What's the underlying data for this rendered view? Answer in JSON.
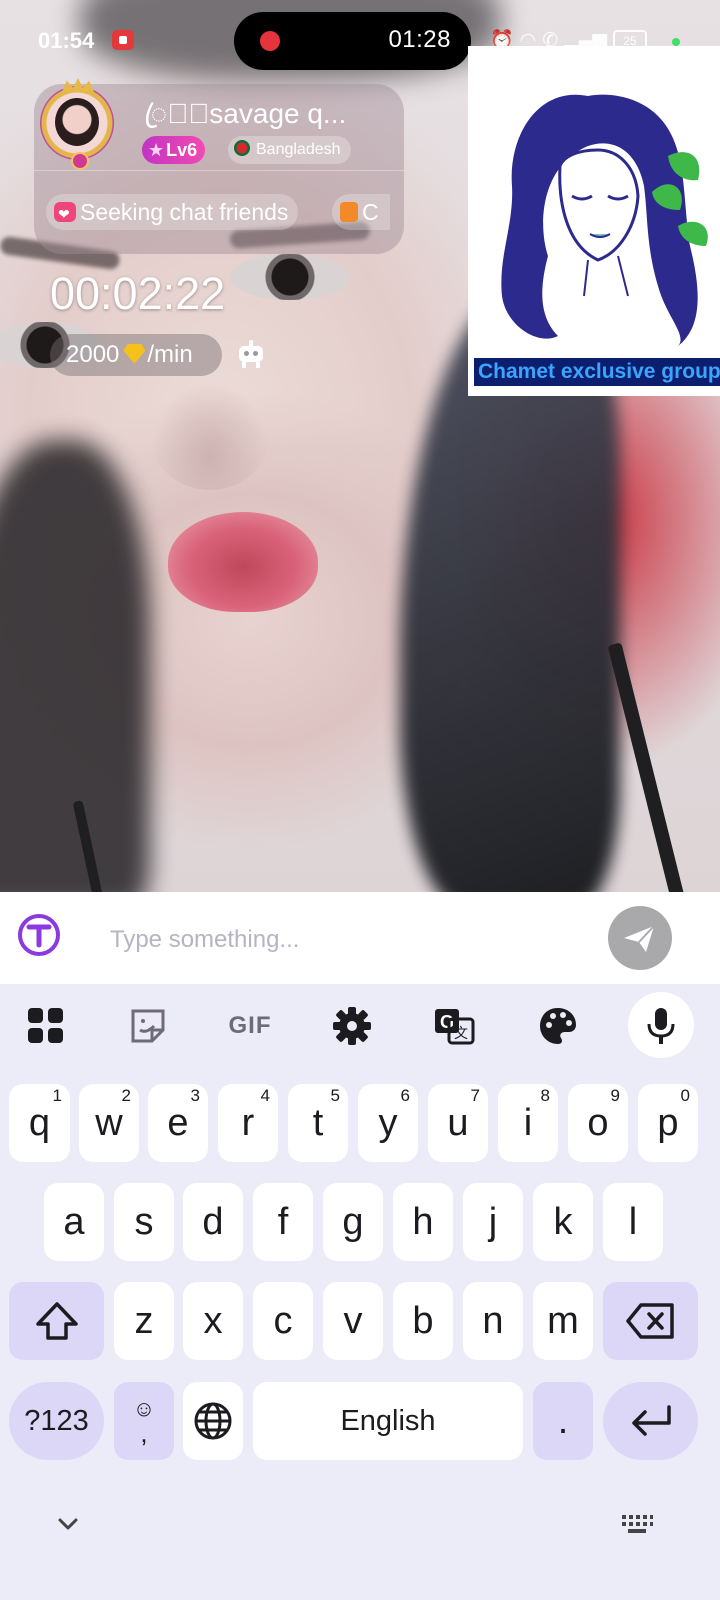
{
  "status_bar": {
    "time": "01:54",
    "battery": "25"
  },
  "recording": {
    "elapsed": "01:28"
  },
  "profile": {
    "username": "ꦿ꧂⃤savage q...",
    "level": "Lv6",
    "country": "Bangladesh",
    "tag_primary": "Seeking chat friends",
    "tag_secondary": "C"
  },
  "call": {
    "duration": "00:02:22",
    "rate_value": "2000",
    "rate_unit": "/min"
  },
  "overlay_logo": {
    "caption": "Chamet exclusive group"
  },
  "chat": {
    "placeholder": "Type something..."
  },
  "keyboard": {
    "toolbar": [
      "apps-grid-icon",
      "sticker-icon",
      "gif-icon",
      "gear-icon",
      "translate-icon",
      "palette-icon",
      "microphone-icon"
    ],
    "gif_label": "GIF",
    "row1": [
      {
        "key": "q",
        "hint": "1"
      },
      {
        "key": "w",
        "hint": "2"
      },
      {
        "key": "e",
        "hint": "3"
      },
      {
        "key": "r",
        "hint": "4"
      },
      {
        "key": "t",
        "hint": "5"
      },
      {
        "key": "y",
        "hint": "6"
      },
      {
        "key": "u",
        "hint": "7"
      },
      {
        "key": "i",
        "hint": "8"
      },
      {
        "key": "o",
        "hint": "9"
      },
      {
        "key": "p",
        "hint": "0"
      }
    ],
    "row2": [
      "a",
      "s",
      "d",
      "f",
      "g",
      "h",
      "j",
      "k",
      "l"
    ],
    "row3": [
      "z",
      "x",
      "c",
      "v",
      "b",
      "n",
      "m"
    ],
    "symbols_label": "?123",
    "emoji_comma": ",",
    "space_label": "English",
    "period": "."
  },
  "colors": {
    "accent": "#dcd6f7",
    "keyboard_bg": "#ecebf8",
    "send_button": "#a9a9ab",
    "level_badge": "#d23cb9"
  }
}
